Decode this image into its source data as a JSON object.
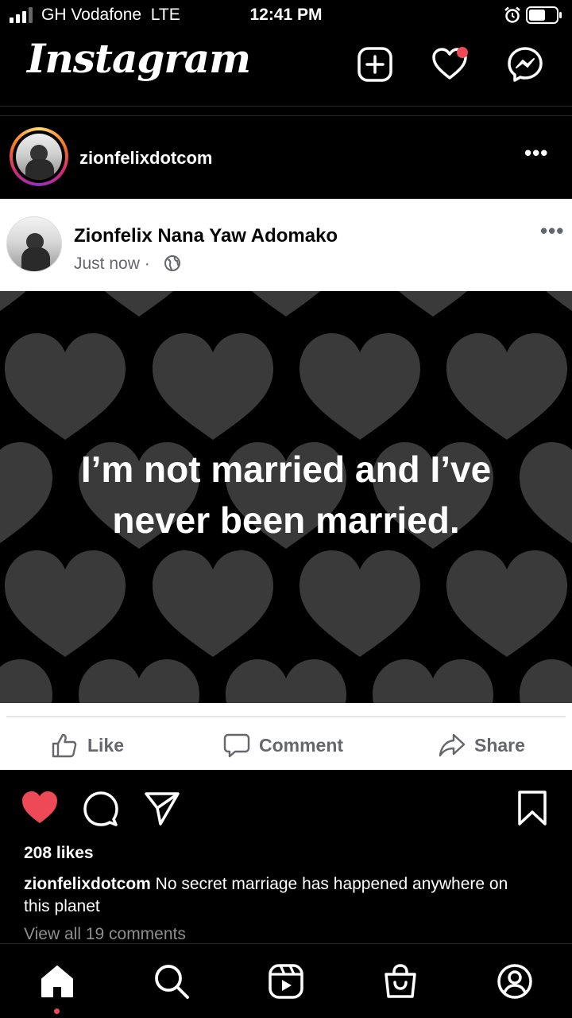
{
  "status_bar": {
    "carrier": "GH Vodafone",
    "network": "LTE",
    "time": "12:41 PM"
  },
  "app": {
    "title": "Instagram"
  },
  "header_icons": [
    "new-post-icon",
    "heart-icon",
    "messenger-icon"
  ],
  "post": {
    "username": "zionfelixdotcom",
    "more": "•••"
  },
  "shared_facebook_post": {
    "author": "Zionfelix Nana Yaw Adomako",
    "timestamp": "Just now ·",
    "more": "•••",
    "quote_line1": "I’m not married and I’ve",
    "quote_line2": "never been married.",
    "actions": {
      "like": "Like",
      "comment": "Comment",
      "share": "Share"
    }
  },
  "engagement": {
    "likes": "208 likes",
    "caption_user": "zionfelixdotcom",
    "caption_text": " No secret marriage has happened anywhere on this planet",
    "view_comments": "View all 19 comments"
  },
  "colors": {
    "like_red": "#ed4956",
    "fb_gray": "#65676b",
    "heart_gray": "#3a3a3a"
  },
  "nav_icons": [
    "home-icon",
    "search-icon",
    "reels-icon",
    "shop-icon",
    "profile-icon"
  ]
}
